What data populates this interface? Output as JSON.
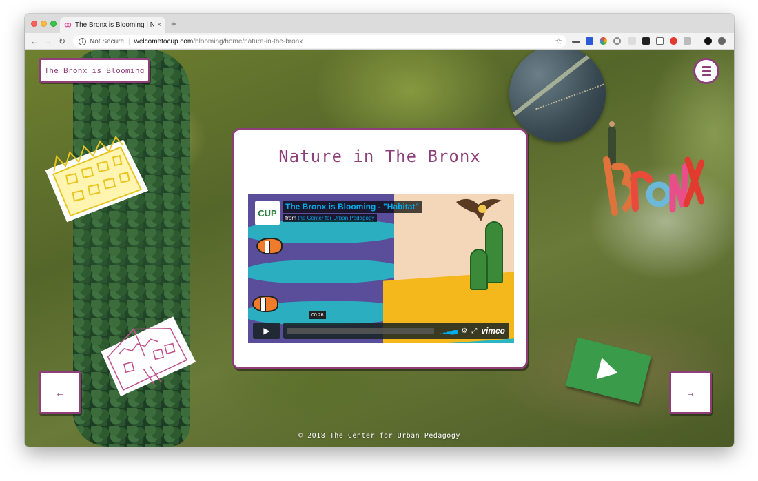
{
  "browser": {
    "tab_title": "The Bronx is Blooming | Nature",
    "tab_close": "×",
    "new_tab": "+",
    "security_label": "Not Secure",
    "url_host": "welcometocup.com",
    "url_path": "/blooming/home/nature-in-the-bronx"
  },
  "site": {
    "title": "The Bronx is Blooming",
    "page_heading": "Nature in The Bronx",
    "prev_label": "←",
    "next_label": "→",
    "footer": "© 2018 The Center for Urban Pedagogy"
  },
  "video": {
    "title": "The Bronx is Blooming - \"Habitat\"",
    "from_label": "from",
    "from_link": "the Center for Urban Pedagogy",
    "logo_text": "CUP",
    "time": "00:26",
    "brand": "vimeo"
  },
  "colors": {
    "accent": "#8e3f7a",
    "vimeo_blue": "#00adef"
  },
  "icons": [
    "back-arrow-icon",
    "forward-arrow-icon",
    "reload-icon",
    "info-icon",
    "star-icon",
    "hamburger-menu-icon",
    "play-icon"
  ]
}
